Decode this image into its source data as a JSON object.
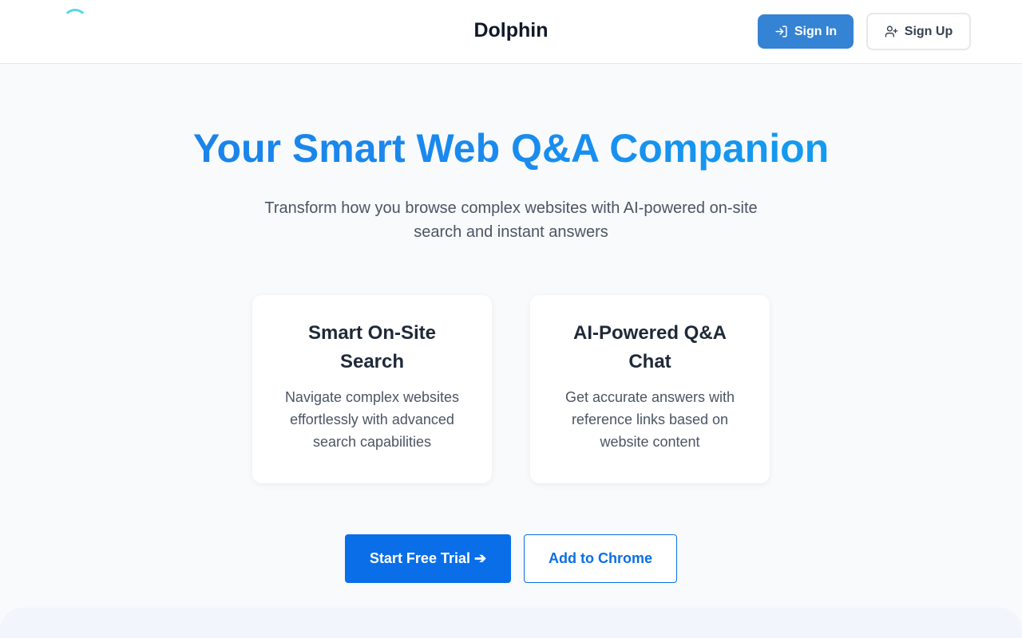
{
  "header": {
    "brand": "Dolphin",
    "sign_in_label": "Sign In",
    "sign_up_label": "Sign Up"
  },
  "hero": {
    "title": "Your Smart Web Q&A Companion",
    "subtitle": "Transform how you browse complex websites with AI-powered on-site search and instant answers"
  },
  "features": [
    {
      "title": "Smart On-Site Search",
      "description": "Navigate complex websites effortlessly with advanced search capabilities"
    },
    {
      "title": "AI-Powered Q&A Chat",
      "description": "Get accurate answers with reference links based on website content"
    }
  ],
  "cta": {
    "trial_label": "Start Free Trial ➔",
    "chrome_label": "Add to Chrome"
  },
  "icons": {
    "sign_in": "log-in-icon",
    "sign_up": "user-plus-icon"
  },
  "colors": {
    "primary": "#0a6ee8",
    "sign_in_bg": "#3483d4",
    "title_gradient_start": "#1a7fe6",
    "title_gradient_end": "#0ea5f0",
    "page_bg": "#f8fafc"
  }
}
